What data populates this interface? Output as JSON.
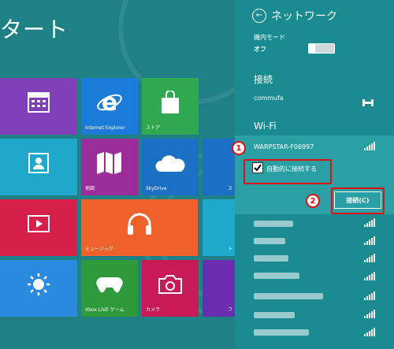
{
  "start": {
    "title": "タート",
    "tiles": {
      "calendar": {
        "label": ""
      },
      "ie": {
        "label": "Internet Explorer"
      },
      "store": {
        "label": "ストア"
      },
      "people": {
        "label": ""
      },
      "photos": {
        "label": "地図"
      },
      "skydrive": {
        "label": "SkyDrive"
      },
      "video": {
        "label": ""
      },
      "music": {
        "label": "ミュージック"
      },
      "weather": {
        "label": ""
      },
      "xbox": {
        "label": "Xbox LIVE ゲーム"
      },
      "camera": {
        "label": "カメラ"
      }
    },
    "edge_letters": [
      "ス",
      "ト",
      "フ"
    ]
  },
  "network": {
    "title": "ネットワーク",
    "airplane_label": "機内モード",
    "airplane_value": "オフ",
    "connections_heading": "接続",
    "current_connection": "commufa",
    "wifi_heading": "Wi-Fi",
    "selected_network": "WARPSTAR-F06997",
    "auto_connect_label": "自動的に接続する",
    "connect_button": "接続(C)",
    "callout_1": "1",
    "callout_2": "2"
  },
  "colors": {
    "panel_bg": "#1b8b92",
    "selected_row": "#2aa0a5",
    "highlight_red": "#e01010"
  }
}
